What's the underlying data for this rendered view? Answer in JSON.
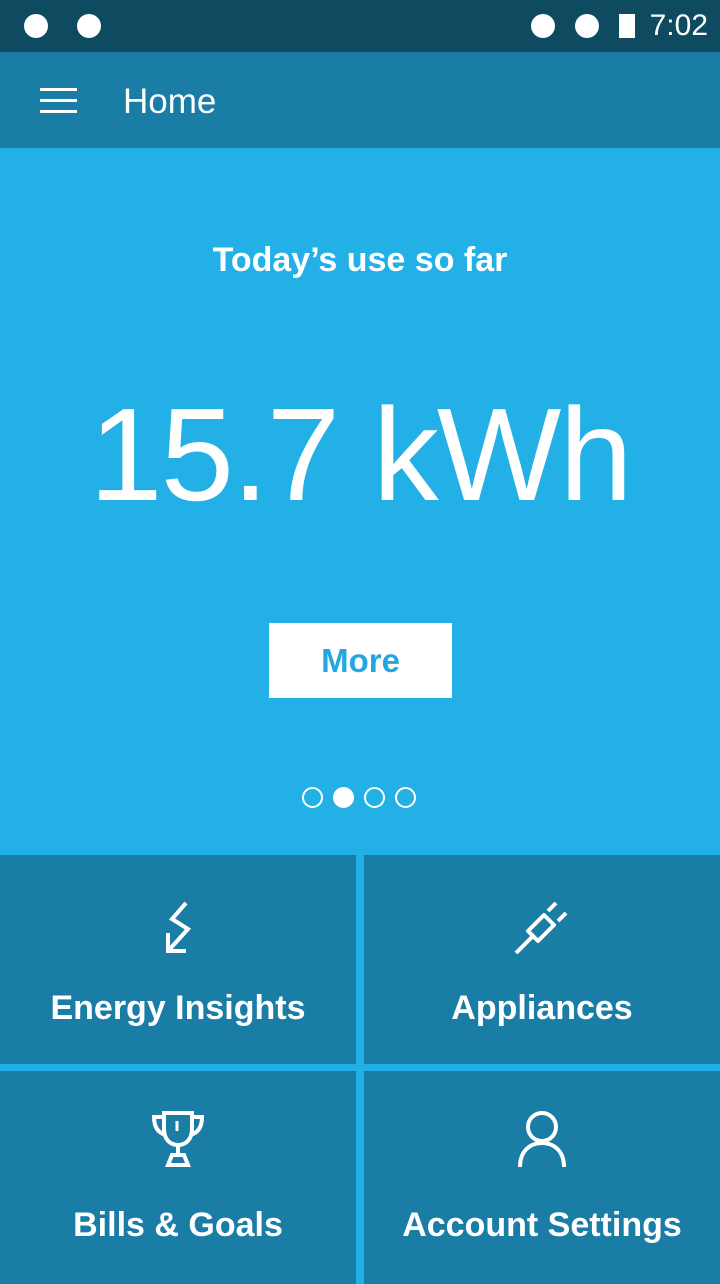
{
  "status_bar": {
    "time": "7:02"
  },
  "app_bar": {
    "title": "Home"
  },
  "hero": {
    "label": "Today’s use so far",
    "value": "15.7 kWh",
    "more_label": "More",
    "pager": {
      "count": 4,
      "active_index": 1
    }
  },
  "tiles": [
    {
      "label": "Energy Insights",
      "icon": "lightning-arrow-icon"
    },
    {
      "label": "Appliances",
      "icon": "plug-icon"
    },
    {
      "label": "Bills & Goals",
      "icon": "trophy-icon"
    },
    {
      "label": "Account Settings",
      "icon": "person-icon"
    }
  ],
  "colors": {
    "status_bar_bg": "#0e4a60",
    "app_bar_bg": "#1a7da6",
    "hero_bg": "#22b0e6",
    "tile_bg": "#1a7da6",
    "accent_text": "#22a8de"
  }
}
